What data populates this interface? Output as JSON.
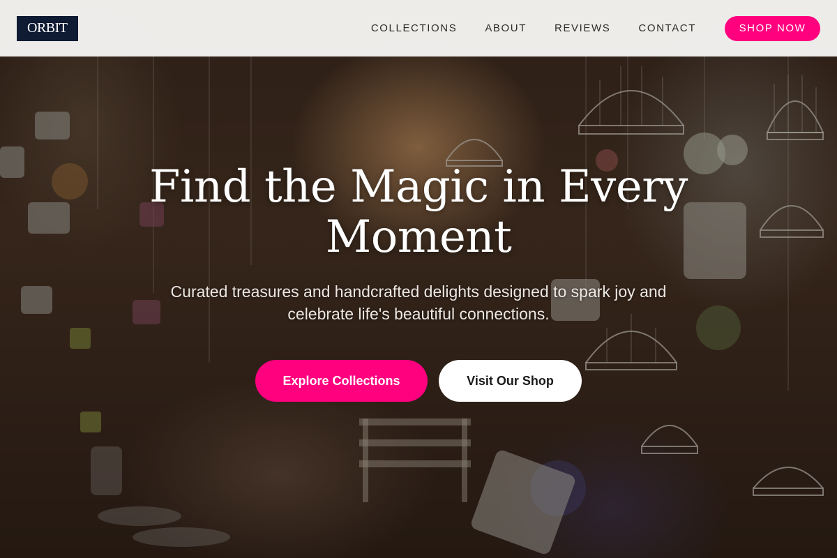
{
  "brand": {
    "logo_text": "ORBIT"
  },
  "nav": {
    "links": [
      "COLLECTIONS",
      "ABOUT",
      "REVIEWS",
      "CONTACT"
    ],
    "cta_label": "SHOP NOW"
  },
  "hero": {
    "title": "Find the Magic in Every Moment",
    "subtitle": "Curated treasures and handcrafted delights designed to spark joy and celebrate life's beautiful connections.",
    "primary_button": "Explore Collections",
    "secondary_button": "Visit Our Shop"
  },
  "colors": {
    "accent": "#ff007f",
    "logo_bg": "#0f1a33",
    "nav_bg": "#f6f5f3",
    "nav_text": "#2c2c2c"
  }
}
